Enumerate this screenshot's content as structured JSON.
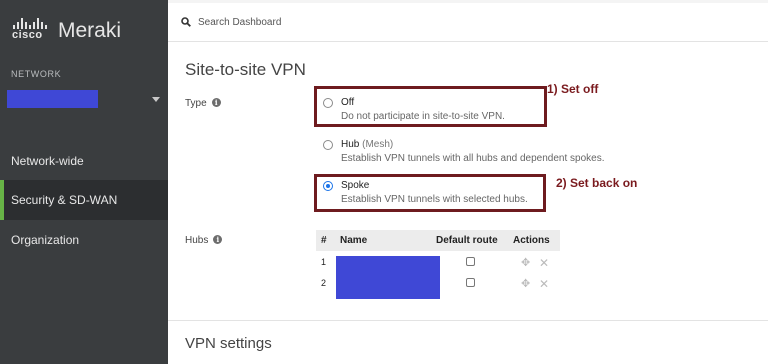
{
  "sidebar": {
    "brand_cisco": "cisco",
    "brand_meraki": "Meraki",
    "network_label": "NETWORK",
    "nav_items": [
      {
        "label": "Network-wide"
      },
      {
        "label": "Security & SD-WAN",
        "active": true
      },
      {
        "label": "Organization"
      }
    ]
  },
  "search": {
    "placeholder": "Search Dashboard"
  },
  "page": {
    "title": "Site-to-site VPN"
  },
  "type_field": {
    "label": "Type",
    "options": [
      {
        "title": "Off",
        "subtitle": "",
        "description": "Do not participate in site-to-site VPN.",
        "selected": false
      },
      {
        "title": "Hub",
        "subtitle": "(Mesh)",
        "description": "Establish VPN tunnels with all hubs and dependent spokes.",
        "selected": false
      },
      {
        "title": "Spoke",
        "subtitle": "",
        "description": "Establish VPN tunnels with selected hubs.",
        "selected": true
      }
    ]
  },
  "annotations": {
    "set_off": "1) Set off",
    "set_back_on": "2) Set back on",
    "color": "#7a1a1e"
  },
  "hubs": {
    "label": "Hubs",
    "columns": [
      "#",
      "Name",
      "Default route",
      "Actions"
    ],
    "rows": [
      {
        "num": "1",
        "default_route": false
      },
      {
        "num": "2",
        "default_route": false
      }
    ]
  },
  "vpn_settings": {
    "title": "VPN settings"
  },
  "colors": {
    "sidebar_bg": "#3a3d3f",
    "active_accent": "#67b346",
    "redaction": "#3f48d6",
    "radio_selected": "#1a73e8"
  }
}
